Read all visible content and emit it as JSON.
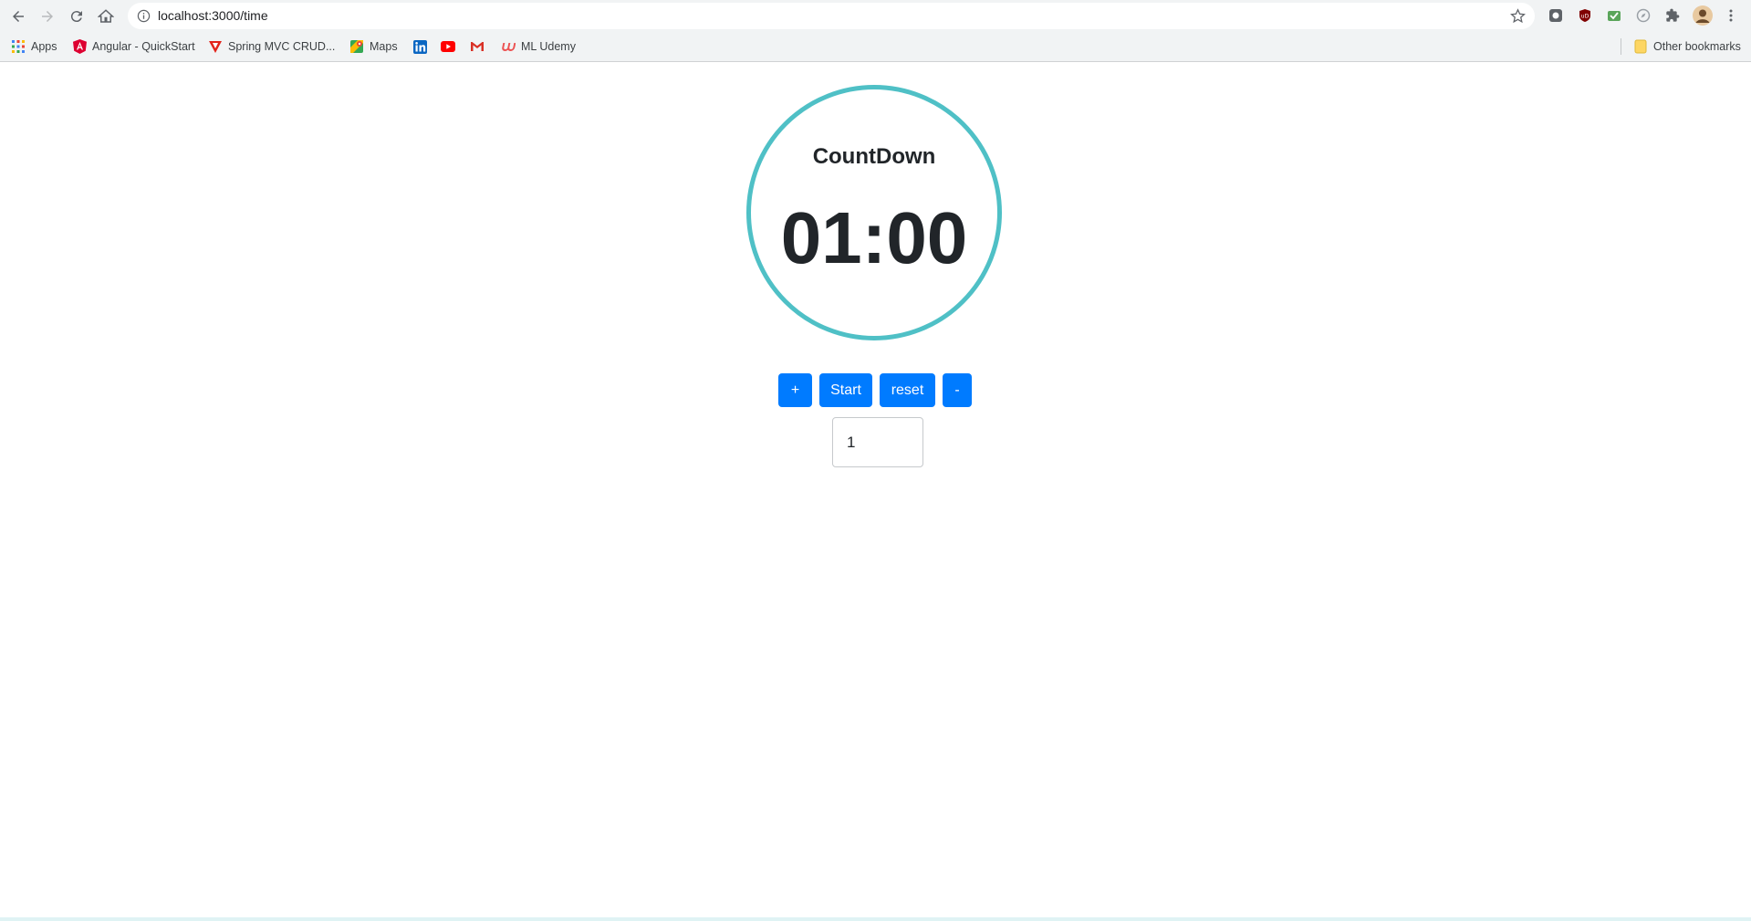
{
  "browser": {
    "url": "localhost:3000/time",
    "bookmarks": [
      {
        "label": "Apps",
        "icon": "apps-grid-icon"
      },
      {
        "label": "Angular - QuickStart",
        "icon": "angular-icon"
      },
      {
        "label": "Spring MVC CRUD...",
        "icon": "spring-icon"
      },
      {
        "label": "Maps",
        "icon": "maps-icon"
      },
      {
        "label": "",
        "icon": "linkedin-icon"
      },
      {
        "label": "",
        "icon": "youtube-icon"
      },
      {
        "label": "",
        "icon": "gmail-icon"
      },
      {
        "label": "ML Udemy",
        "icon": "udemy-icon"
      }
    ],
    "other_bookmarks": "Other bookmarks"
  },
  "timer": {
    "title": "CountDown",
    "display": "01:00",
    "ring_color": "#4fc0c6"
  },
  "controls": {
    "plus_label": "+",
    "start_label": "Start",
    "reset_label": "reset",
    "minus_label": "-",
    "button_color": "#007bff"
  },
  "minutes_input": {
    "value": "1"
  }
}
